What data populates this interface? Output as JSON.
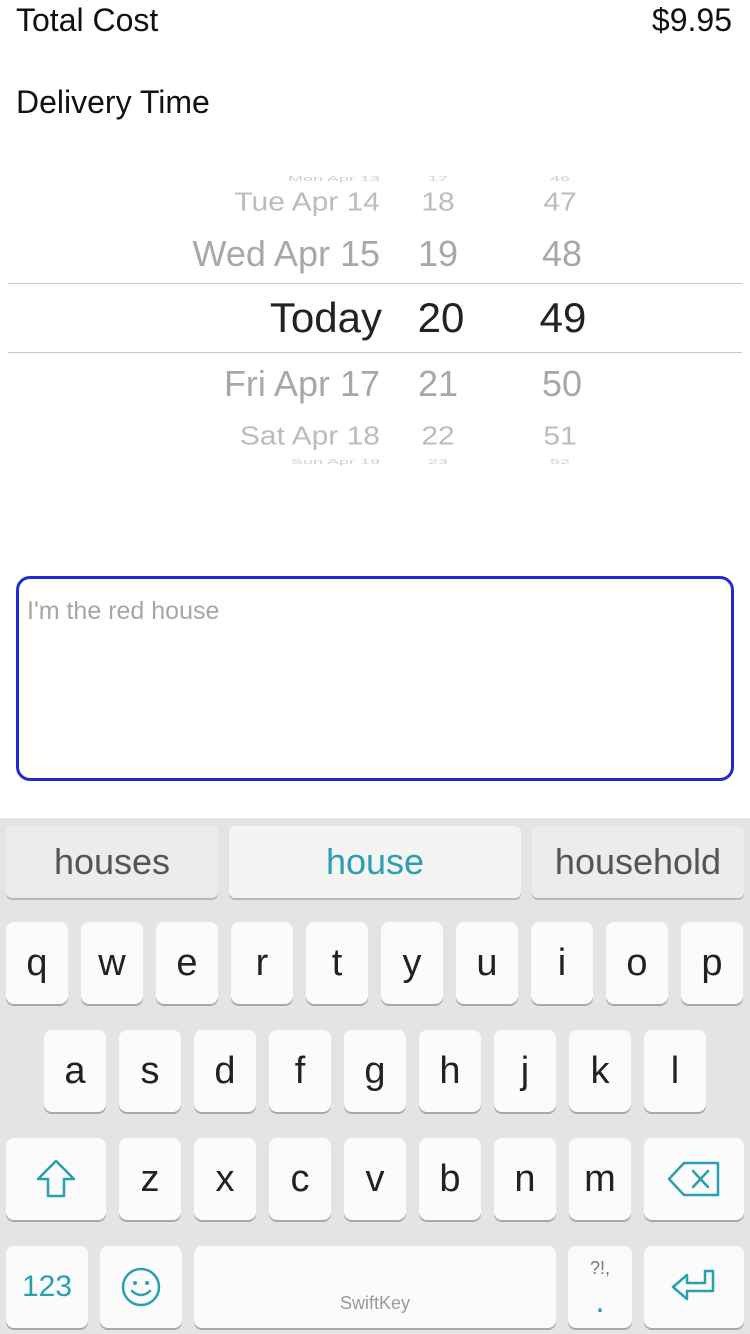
{
  "summary": {
    "total_label": "Total Cost",
    "total_value": "$9.95",
    "delivery_label": "Delivery Time"
  },
  "picker": {
    "dates": [
      "Mon Apr 13",
      "Tue Apr 14",
      "Wed Apr 15",
      "Today",
      "Fri Apr 17",
      "Sat Apr 18",
      "Sun Apr 19"
    ],
    "hours": [
      "17",
      "18",
      "19",
      "20",
      "21",
      "22",
      "23"
    ],
    "minutes": [
      "46",
      "47",
      "48",
      "49",
      "50",
      "51",
      "52"
    ],
    "selected": {
      "date": "Today",
      "hour": "20",
      "minute": "49"
    }
  },
  "notes": {
    "placeholder": "I'm the red house",
    "border_color": "#1f2ad6"
  },
  "keyboard": {
    "accent_color": "#2a9fb0",
    "suggestions": [
      "houses",
      "house",
      "household"
    ],
    "row1": [
      "q",
      "w",
      "e",
      "r",
      "t",
      "y",
      "u",
      "i",
      "o",
      "p"
    ],
    "row2": [
      "a",
      "s",
      "d",
      "f",
      "g",
      "h",
      "j",
      "k",
      "l"
    ],
    "row3": [
      "z",
      "x",
      "c",
      "v",
      "b",
      "n",
      "m"
    ],
    "numbers_label": "123",
    "space_brand": "SwiftKey",
    "punct_top": "?!,",
    "punct_bottom": ".",
    "icons": {
      "shift": "shift-icon",
      "backspace": "backspace-icon",
      "emoji": "emoji-icon",
      "return": "return-icon"
    }
  }
}
